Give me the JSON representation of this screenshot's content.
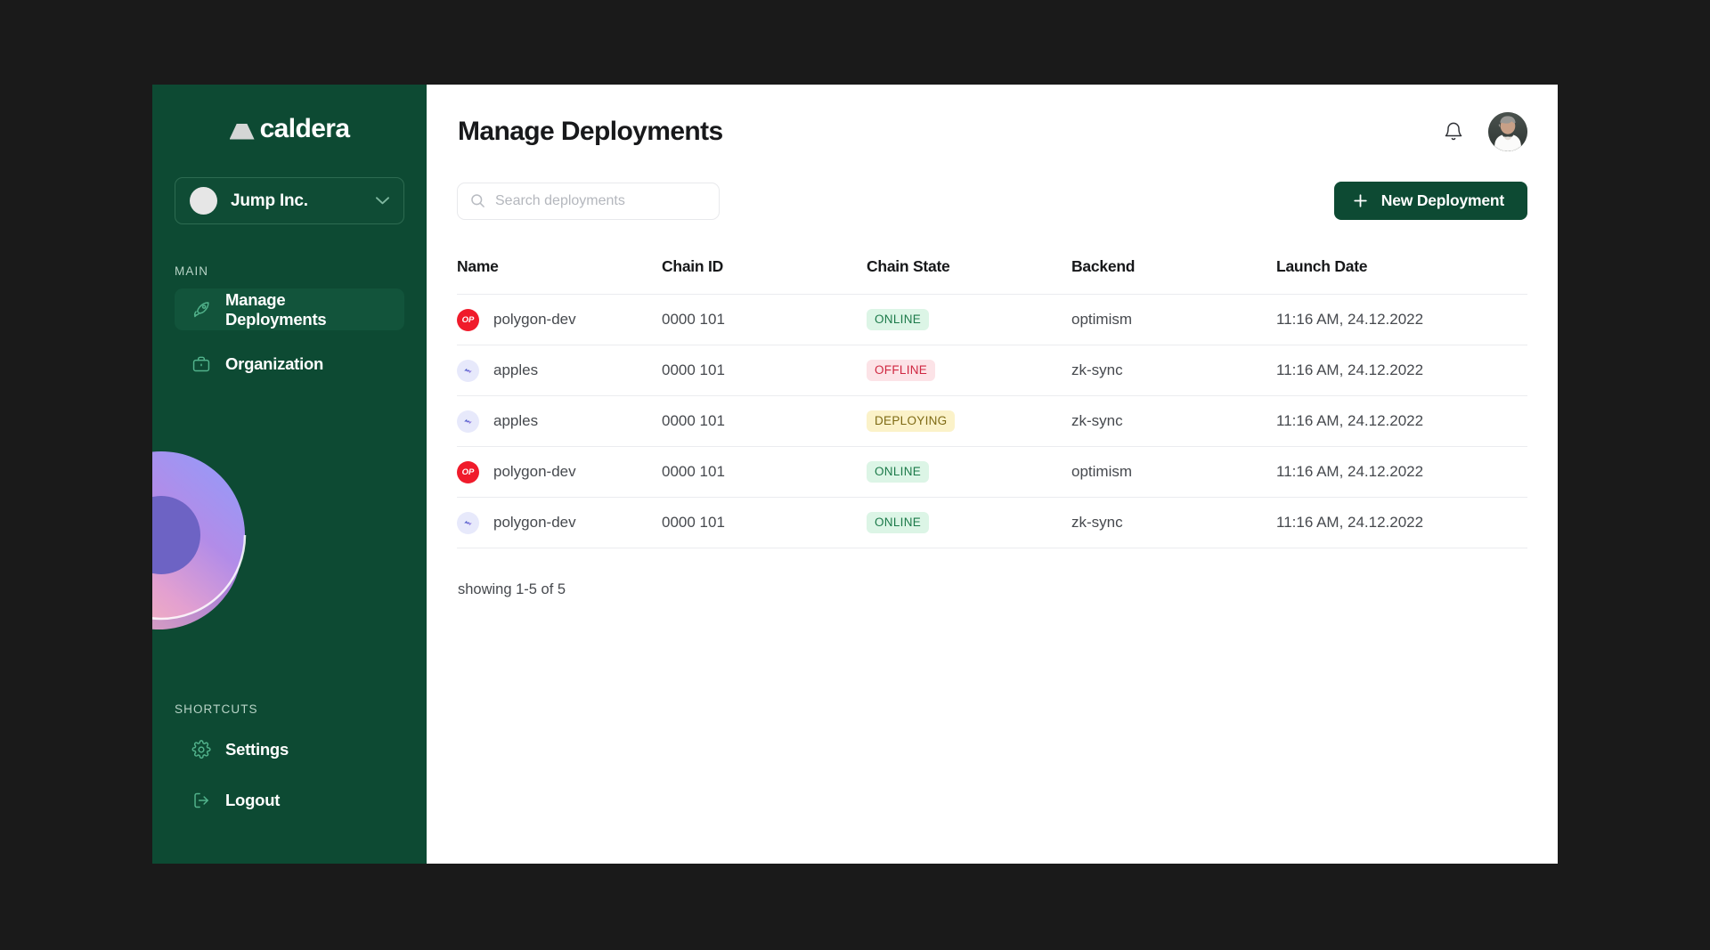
{
  "sidebar": {
    "logo": {
      "mark_icon": "caldera-mountain-icon",
      "word": "caldera"
    },
    "org_selector": {
      "name": "Jump Inc.",
      "chevron_icon": "chevron-down-icon",
      "avatar_icon": "org-avatar"
    },
    "main_section_label": "MAIN",
    "main_items": [
      {
        "label": "Manage Deployments",
        "icon": "rocket-icon",
        "active": true
      },
      {
        "label": "Organization",
        "icon": "briefcase-icon",
        "active": false
      }
    ],
    "shortcuts_section_label": "SHORTCUTS",
    "shortcut_items": [
      {
        "label": "Settings",
        "icon": "gear-icon"
      },
      {
        "label": "Logout",
        "icon": "logout-icon"
      }
    ],
    "decoration_icon": "gradient-torus-decoration",
    "bg_color": "#0d4a33",
    "active_item_color": "#12543b"
  },
  "header": {
    "title": "Manage Deployments",
    "bell_icon": "bell-icon",
    "avatar_icon": "user-avatar"
  },
  "toolbar": {
    "search_placeholder": "Search deployments",
    "search_value": "",
    "search_icon": "search-icon",
    "new_deployment_label": "New Deployment",
    "plus_icon": "plus-icon",
    "button_color": "#0d4a33"
  },
  "table": {
    "columns": [
      "Name",
      "Chain ID",
      "Chain State",
      "Backend",
      "Launch Date"
    ],
    "rows": [
      {
        "logo": "OP",
        "logo_type": "op",
        "name": "polygon-dev",
        "chain_id": "0000 101",
        "state": "ONLINE",
        "state_type": "online",
        "backend": "optimism",
        "launch_date": "11:16 AM, 24.12.2022"
      },
      {
        "logo": "ZK",
        "logo_type": "zk",
        "name": "apples",
        "chain_id": "0000 101",
        "state": "OFFLINE",
        "state_type": "offline",
        "backend": "zk-sync",
        "launch_date": "11:16 AM, 24.12.2022"
      },
      {
        "logo": "ZK",
        "logo_type": "zk",
        "name": "apples",
        "chain_id": "0000 101",
        "state": "DEPLOYING",
        "state_type": "deploying",
        "backend": "zk-sync",
        "launch_date": "11:16 AM, 24.12.2022"
      },
      {
        "logo": "OP",
        "logo_type": "op",
        "name": "polygon-dev",
        "chain_id": "0000 101",
        "state": "ONLINE",
        "state_type": "online",
        "backend": "optimism",
        "launch_date": "11:16 AM, 24.12.2022"
      },
      {
        "logo": "ZK",
        "logo_type": "zk",
        "name": "polygon-dev",
        "chain_id": "0000 101",
        "state": "ONLINE",
        "state_type": "online",
        "backend": "zk-sync",
        "launch_date": "11:16 AM, 24.12.2022"
      }
    ],
    "showing_text": "showing 1-5 of 5"
  },
  "status_colors": {
    "online_bg": "#dcf5e6",
    "online_fg": "#1c7a4a",
    "offline_bg": "#fce3e7",
    "offline_fg": "#cf2741",
    "deploying_bg": "#fbf2c9",
    "deploying_fg": "#7e6a14"
  }
}
